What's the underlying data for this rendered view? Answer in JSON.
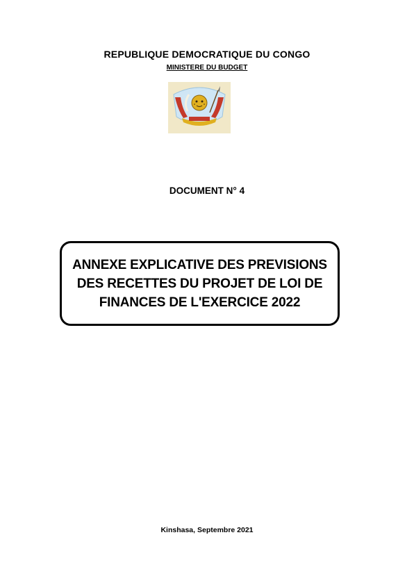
{
  "header": {
    "country": "REPUBLIQUE DEMOCRATIQUE DU CONGO",
    "ministry": "MINISTERE DU BUDGET"
  },
  "emblem": {
    "icon": "coat-of-arms-icon",
    "colors": {
      "sky": "#cfe6f5",
      "gold": "#e0b020",
      "red": "#c43a2a",
      "sand": "#f1e8c8"
    }
  },
  "document": {
    "number": "DOCUMENT N° 4"
  },
  "title": {
    "text": "ANNEXE EXPLICATIVE  DES PREVISIONS\nDES RECETTES DU PROJET DE LOI DE\nFINANCES DE L'EXERCICE 2022"
  },
  "footer": {
    "place_date": "Kinshasa, Septembre 2021"
  }
}
